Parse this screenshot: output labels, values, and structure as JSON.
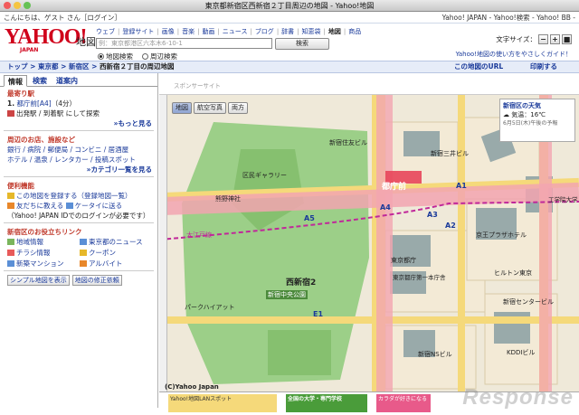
{
  "window": {
    "title": "東京都新宿区西新宿２丁目周辺の地図 - Yahoo!地図"
  },
  "topbar": {
    "greeting": "こんにちは、ゲスト さん［ログイン］",
    "links": "Yahoo! JAPAN - Yahoo!検索 - Yahoo! BB -"
  },
  "header": {
    "logo": "YAHOO!",
    "logo_sub": "JAPAN",
    "service": "地図",
    "nav": [
      "ウェブ",
      "登録サイト",
      "画像",
      "音楽",
      "動画",
      "ニュース",
      "ブログ",
      "辞書",
      "知恵袋",
      "地図",
      "商品"
    ],
    "nav_current": "地図",
    "search_placeholder": "例：東京都港区六本木6-10-1",
    "search_button": "検索",
    "radio_1": "地図検索",
    "radio_2": "周辺検索",
    "fontsize_label": "文字サイズ：",
    "help": "Yahoo!地図の使い方をやさしくガイド！"
  },
  "breadcrumb": {
    "items": [
      "トップ",
      "東京都",
      "新宿区"
    ],
    "current": "西新宿２丁目の周辺地図",
    "url_link": "この地図のURL",
    "print_link": "印刷する"
  },
  "sidebar": {
    "tabs": [
      "情報",
      "検索",
      "道案内"
    ],
    "station": {
      "header": "最寄り駅",
      "entry_num": "1.",
      "entry": "都庁前[A4]",
      "dist": "（4分）",
      "action": "出発駅 / 到着駅 にして探索",
      "more": "»もっと見る"
    },
    "shops": {
      "header": "周辺のお店、施設など",
      "line1": "銀行 / 病院 / 郵便局 / コンビニ / 居酒屋",
      "line2": "ホテル / 温泉 / レンタカー / 投稿スポット",
      "more": "»カテゴリ一覧を見る"
    },
    "tools": {
      "header": "便利機能",
      "register": "この地図を登録する（登録地図一覧）",
      "friend": "友だちに教える",
      "mobile": "ケータイに送る",
      "note": "（Yahoo! JAPAN IDでのログインが必要です）"
    },
    "links": {
      "header": "新宿区のお役立ちリンク",
      "items": [
        "地域情報",
        "東京都のニュース",
        "チラシ情報",
        "クーポン",
        "新築マンション",
        "アルバイト"
      ]
    },
    "simple_map": "シンプル地図を表示",
    "fix_request": "地図の修正依頼"
  },
  "map": {
    "ad_label": "スポンサーサイト",
    "btn_map": "地図",
    "btn_aerial": "航空写真",
    "btn_both": "両方",
    "weather_title": "新宿区の天気",
    "weather_temp": "気温：16℃",
    "weather_time": "6月5日(木)午後の予報",
    "copyright": "(C)Yahoo Japan",
    "labels": {
      "park": "西新宿2",
      "park2": "新宿中央公園",
      "gallery": "区民ギャラリー",
      "shrine": "熊野神社",
      "station": "都庁前",
      "tocho": "東京都庁",
      "tocho_bldg": "東京都庁第一本庁舎",
      "hilton": "ヒルトン東京",
      "sumitomo": "新宿住友ビル",
      "ns": "新宿NSビル",
      "kddi": "KDDIビル",
      "keio": "京王プラザホテル",
      "kogakuin": "工学院大学",
      "center": "新宿センタービル",
      "mitsui": "新宿三井ビル",
      "park_tower": "パークハイアット",
      "a5": "A5",
      "a1": "A1",
      "a2": "A2",
      "a3": "A3",
      "a4": "A4",
      "e1": "E1",
      "oedo": "大江戸線"
    }
  },
  "footer": {
    "ad1": "Yahoo!地図LANスポット",
    "ad2": "全国の大学・専門学校",
    "ad3": "カラダが好きになる",
    "watermark": "Response"
  },
  "colors": {
    "accent_red": "#d0021b",
    "link_blue": "#1a3a9a",
    "map_bg": "#eaedc8",
    "park_green": "#9ccf88",
    "road_pink": "#f2a5b0",
    "road_yellow": "#f5d97a"
  }
}
